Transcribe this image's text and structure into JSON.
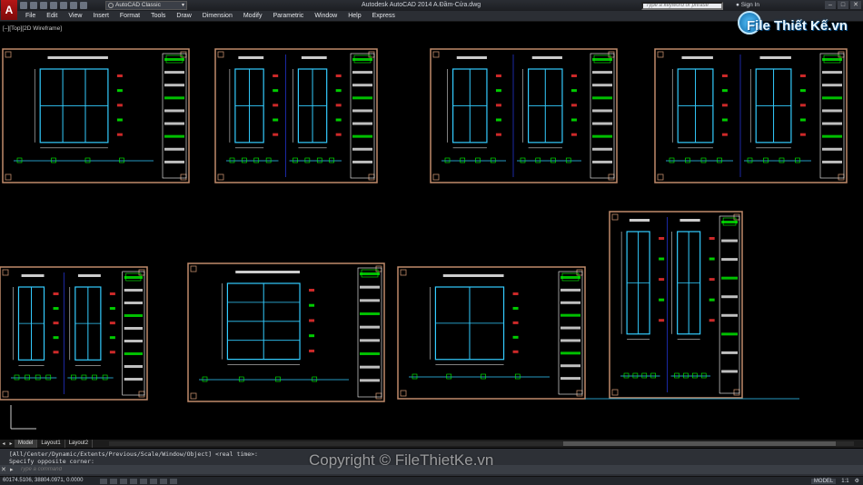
{
  "titlebar": {
    "logo_letter": "A",
    "workspace": "AutoCAD Classic",
    "title": "Autodesk AutoCAD 2014    A.Đầm-Cửa.dwg",
    "search_placeholder": "Type a keyword or phrase",
    "signin": "Sign In",
    "window_buttons": [
      "–",
      "□",
      "✕"
    ]
  },
  "menu": [
    "File",
    "Edit",
    "View",
    "Insert",
    "Format",
    "Tools",
    "Draw",
    "Dimension",
    "Modify",
    "Parametric",
    "Window",
    "Help",
    "Express"
  ],
  "viewport_label": "[–][Top][2D Wireframe]",
  "brand": "File Thiết Kế.vn",
  "tabs": {
    "items": [
      "Model",
      "Layout1",
      "Layout2"
    ],
    "active": "Model"
  },
  "command": {
    "history_1": "[All/Center/Dynamic/Extents/Previous/Scale/Window/Object] <real time>:",
    "history_2": "Specify opposite corner:",
    "placeholder": "Type a command"
  },
  "status": {
    "coords": "60174.5106, 38804.0971, 0.0000",
    "model": "MODEL",
    "scale": "1:1"
  },
  "copyright": "Copyright © FileThietKe.vn",
  "colors": {
    "frame": "#c08a6a",
    "outline": "#33ccff",
    "sheet_title": "#ffffff",
    "detail": "#00ff00",
    "accent": "#ff3333",
    "background": "#000000"
  }
}
